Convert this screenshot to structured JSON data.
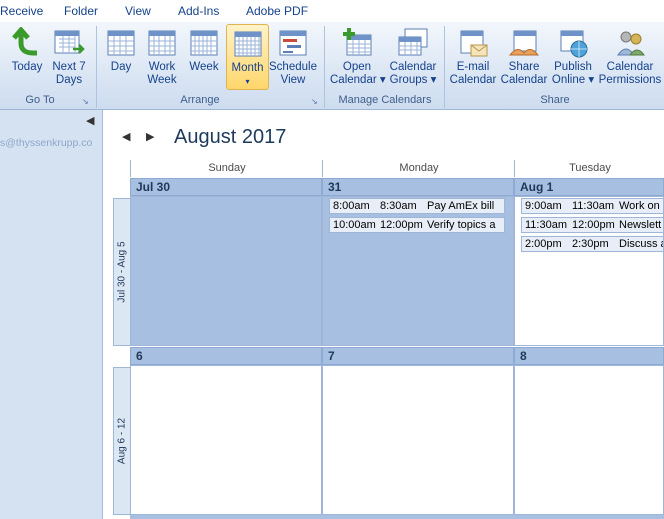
{
  "menu": [
    "Receive",
    "Folder",
    "View",
    "Add-Ins",
    "Adobe PDF"
  ],
  "ribbon": {
    "goto": {
      "label": "Go To",
      "buttons": [
        "Today",
        "Next 7\nDays"
      ]
    },
    "arrange": {
      "label": "Arrange",
      "buttons": [
        "Day",
        "Work\nWeek",
        "Week",
        "Month",
        "Schedule\nView"
      ]
    },
    "manage": {
      "label": "Manage Calendars",
      "buttons": [
        "Open\nCalendar ▾",
        "Calendar\nGroups ▾"
      ]
    },
    "share": {
      "label": "Share",
      "buttons": [
        "E-mail\nCalendar",
        "Share\nCalendar",
        "Publish\nOnline ▾",
        "Calendar\nPermissions"
      ]
    }
  },
  "navpane": {
    "email": "s@thyssenkrupp.co"
  },
  "calendar": {
    "title": "August 2017",
    "days_of_week": [
      "Sunday",
      "Monday",
      "Tuesday"
    ],
    "weeks": [
      {
        "label": "Jul 30 - Aug 5",
        "days": [
          "Jul 30",
          "31",
          "Aug 1"
        ]
      },
      {
        "label": "Aug 6 - 12",
        "days": [
          "6",
          "7",
          "8"
        ]
      }
    ],
    "appointments": {
      "mon31": [
        {
          "start": "8:00am",
          "end": "8:30am",
          "subject": "Pay AmEx bill"
        },
        {
          "start": "10:00am",
          "end": "12:00pm",
          "subject": "Verify topics a"
        }
      ],
      "tueAug1": [
        {
          "start": "9:00am",
          "end": "11:30am",
          "subject": "Work on"
        },
        {
          "start": "11:30am",
          "end": "12:00pm",
          "subject": "Newslett"
        },
        {
          "start": "2:00pm",
          "end": "2:30pm",
          "subject": "Discuss a"
        }
      ]
    }
  }
}
